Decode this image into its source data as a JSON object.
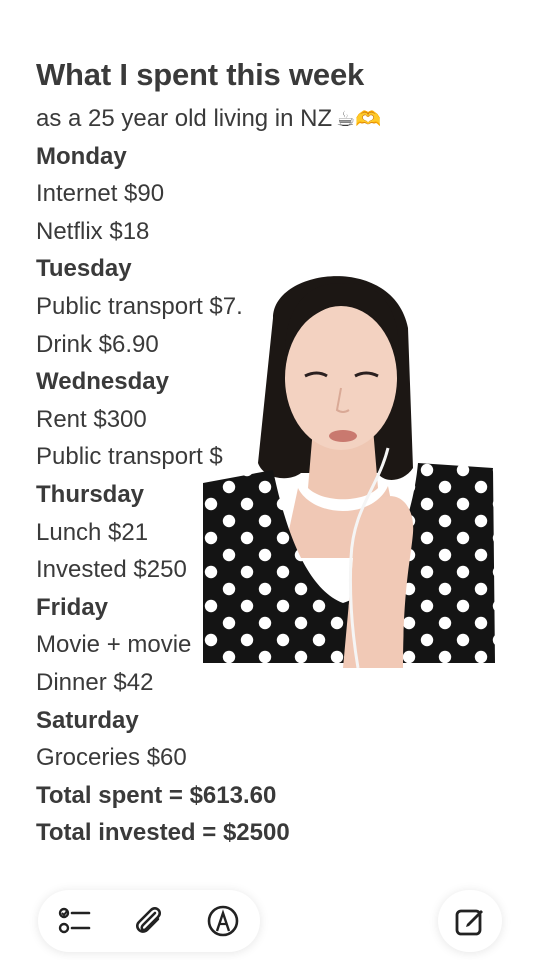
{
  "note": {
    "title": "What I spent this week",
    "subtitle": "as a 25 year old living in NZ",
    "subtitle_emojis": "☕🫶",
    "lines": [
      {
        "text": "Monday",
        "bold": true
      },
      {
        "text": "Internet $90",
        "bold": false
      },
      {
        "text": "Netflix $18",
        "bold": false
      },
      {
        "text": "Tuesday",
        "bold": true
      },
      {
        "text": "Public transport $7.",
        "bold": false
      },
      {
        "text": "Drink $6.90",
        "bold": false
      },
      {
        "text": "Wednesday",
        "bold": true
      },
      {
        "text": "Rent $300",
        "bold": false
      },
      {
        "text": "Public transport $",
        "bold": false
      },
      {
        "text": "Thursday",
        "bold": true
      },
      {
        "text": "Lunch $21",
        "bold": false
      },
      {
        "text": "Invested $250",
        "bold": false
      },
      {
        "text": "Friday",
        "bold": true
      },
      {
        "text": "Movie + movie",
        "bold": false
      },
      {
        "text": "Dinner $42",
        "bold": false
      },
      {
        "text": "Saturday",
        "bold": true
      },
      {
        "text": "Groceries $60",
        "bold": false
      },
      {
        "text": "Total spent = $613.60",
        "bold": true
      },
      {
        "text": "Total invested = $2500",
        "bold": true
      }
    ]
  },
  "toolbar": {
    "icons": [
      "checklist-icon",
      "attachment-icon",
      "markup-icon"
    ],
    "compose_icon": "compose-icon"
  },
  "colors": {
    "text": "#3a3a3a",
    "background": "#ffffff",
    "dress": "#141414",
    "dots": "#ffffff"
  }
}
